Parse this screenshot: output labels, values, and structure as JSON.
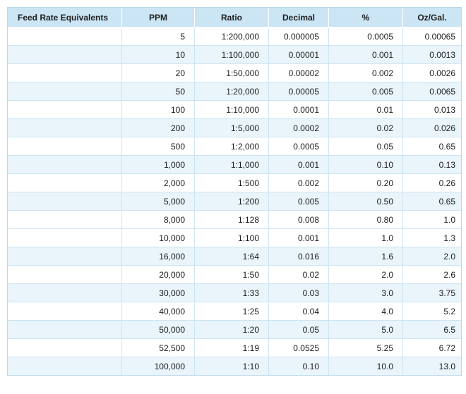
{
  "chart_data": {
    "type": "table",
    "title": "Feed Rate Equivalents",
    "columns": [
      "Feed Rate Equivalents",
      "PPM",
      "Ratio",
      "Decimal",
      "%",
      "Oz/Gal."
    ],
    "rows": [
      [
        "5",
        "1:200,000",
        "0.000005",
        "0.0005",
        "0.00065"
      ],
      [
        "10",
        "1:100,000",
        "0.00001",
        "0.001",
        "0.0013"
      ],
      [
        "20",
        "1:50,000",
        "0.00002",
        "0.002",
        "0.0026"
      ],
      [
        "50",
        "1:20,000",
        "0.00005",
        "0.005",
        "0.0065"
      ],
      [
        "100",
        "1:10,000",
        "0.0001",
        "0.01",
        "0.013"
      ],
      [
        "200",
        "1:5,000",
        "0.0002",
        "0.02",
        "0.026"
      ],
      [
        "500",
        "1:2,000",
        "0.0005",
        "0.05",
        "0.65"
      ],
      [
        "1,000",
        "1:1,000",
        "0.001",
        "0.10",
        "0.13"
      ],
      [
        "2,000",
        "1:500",
        "0.002",
        "0.20",
        "0.26"
      ],
      [
        "5,000",
        "1:200",
        "0.005",
        "0.50",
        "0.65"
      ],
      [
        "8,000",
        "1:128",
        "0.008",
        "0.80",
        "1.0"
      ],
      [
        "10,000",
        "1:100",
        "0.001",
        "1.0",
        "1.3"
      ],
      [
        "16,000",
        "1:64",
        "0.016",
        "1.6",
        "2.0"
      ],
      [
        "20,000",
        "1:50",
        "0.02",
        "2.0",
        "2.6"
      ],
      [
        "30,000",
        "1:33",
        "0.03",
        "3.0",
        "3.75"
      ],
      [
        "40,000",
        "1:25",
        "0.04",
        "4.0",
        "5.2"
      ],
      [
        "50,000",
        "1:20",
        "0.05",
        "5.0",
        "6.5"
      ],
      [
        "52,500",
        "1:19",
        "0.0525",
        "5.25",
        "6.72"
      ],
      [
        "100,000",
        "1:10",
        "0.10",
        "10.0",
        "13.0"
      ]
    ],
    "shaded_row_indices": [
      1,
      3,
      5,
      7,
      9,
      12,
      14,
      16,
      18
    ],
    "layout_hints": {
      "first_column_data_cells_empty": true,
      "data_alignment": "right",
      "header_alignment": "center",
      "grid": "on"
    }
  },
  "colors": {
    "header_bg": "#cbe5f4",
    "row_bg": "#ffffff",
    "row_alt_bg": "#e9f4fb",
    "grid_line": "#cde5f2",
    "outer_border": "#b9d9ec",
    "text": "#1c1c1c"
  }
}
